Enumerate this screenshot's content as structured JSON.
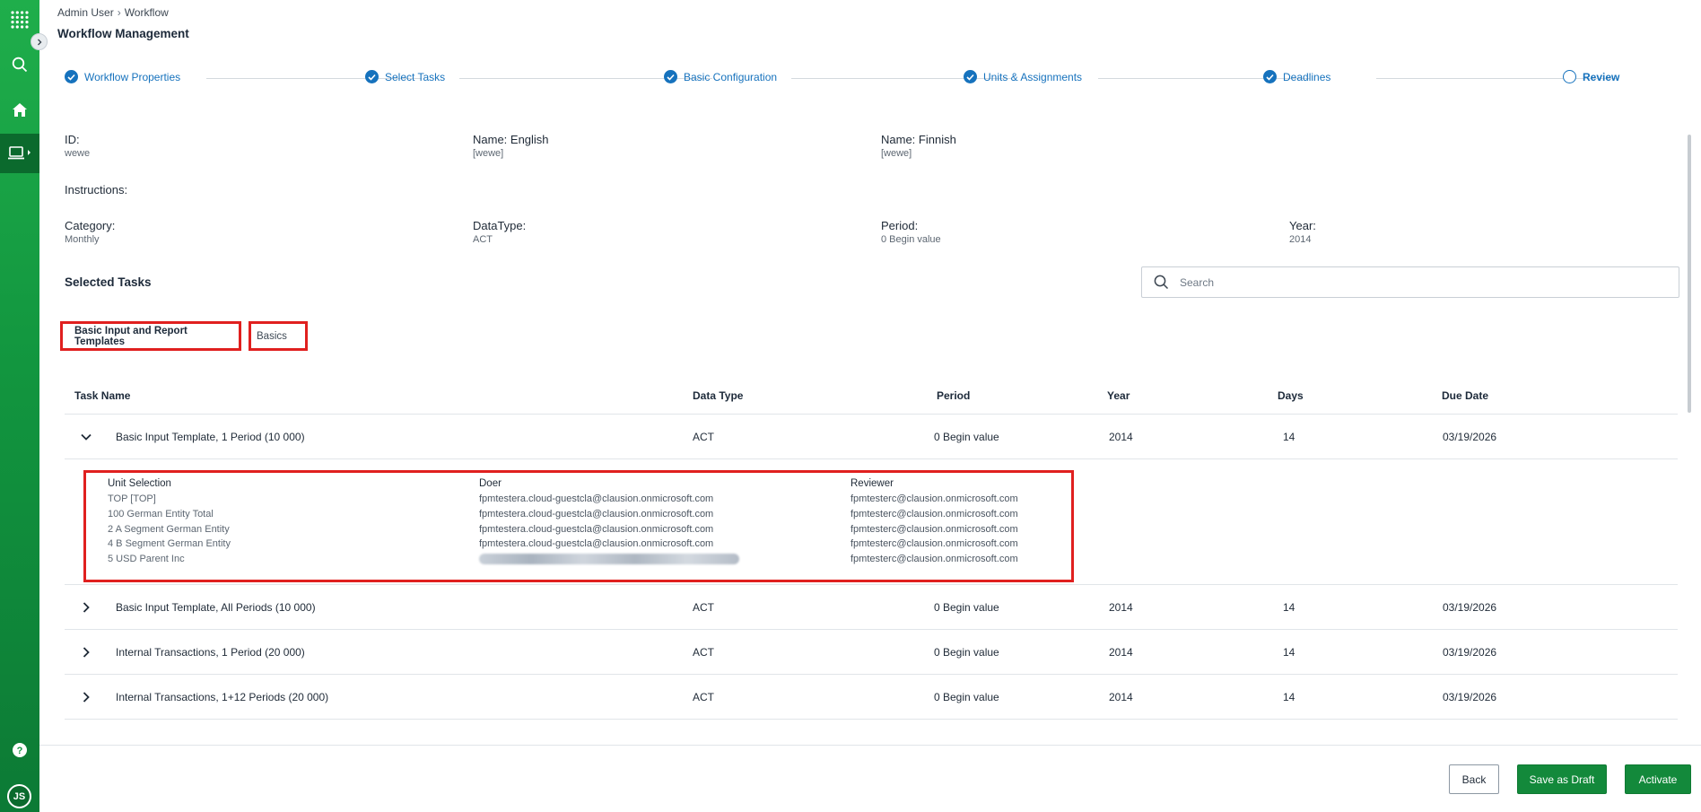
{
  "breadcrumb": {
    "parent": "Admin User",
    "separator": "›",
    "current": "Workflow"
  },
  "page_title": "Workflow Management",
  "stepper": [
    {
      "label": "Workflow Properties",
      "state": "done"
    },
    {
      "label": "Select Tasks",
      "state": "done"
    },
    {
      "label": "Basic Configuration",
      "state": "done"
    },
    {
      "label": "Units & Assignments",
      "state": "done"
    },
    {
      "label": "Deadlines",
      "state": "done"
    },
    {
      "label": "Review",
      "state": "current"
    }
  ],
  "properties": {
    "id": {
      "label": "ID:",
      "value": "wewe"
    },
    "name_en": {
      "label": "Name: English",
      "value": "[wewe]"
    },
    "name_fi": {
      "label": "Name: Finnish",
      "value": "[wewe]"
    },
    "instructions": {
      "label": "Instructions:"
    },
    "category": {
      "label": "Category:",
      "value": "Monthly"
    },
    "datatype": {
      "label": "DataType:",
      "value": "ACT"
    },
    "period": {
      "label": "Period:",
      "value": "0 Begin value"
    },
    "year": {
      "label": "Year:",
      "value": "2014"
    }
  },
  "selected_tasks_title": "Selected Tasks",
  "search": {
    "placeholder": "Search"
  },
  "tabs": [
    {
      "label": "Basic Input and Report Templates",
      "active": true
    },
    {
      "label": "Basics",
      "active": false
    }
  ],
  "table": {
    "columns": [
      "Task Name",
      "Data Type",
      "Period",
      "Year",
      "Days",
      "Due Date"
    ],
    "rows": [
      {
        "name": "Basic Input Template, 1 Period (10 000)",
        "data_type": "ACT",
        "period": "0 Begin value",
        "year": "2014",
        "days": "14",
        "due": "03/19/2026",
        "expanded": true
      },
      {
        "name": "Basic Input Template, All Periods (10 000)",
        "data_type": "ACT",
        "period": "0 Begin value",
        "year": "2014",
        "days": "14",
        "due": "03/19/2026",
        "expanded": false
      },
      {
        "name": "Internal Transactions, 1 Period (20 000)",
        "data_type": "ACT",
        "period": "0 Begin value",
        "year": "2014",
        "days": "14",
        "due": "03/19/2026",
        "expanded": false
      },
      {
        "name": "Internal Transactions, 1+12 Periods (20 000)",
        "data_type": "ACT",
        "period": "0 Begin value",
        "year": "2014",
        "days": "14",
        "due": "03/19/2026",
        "expanded": false
      }
    ]
  },
  "assignments": {
    "headers": {
      "unit": "Unit Selection",
      "doer": "Doer",
      "reviewer": "Reviewer"
    },
    "units": [
      "TOP [TOP]",
      "100 German Entity Total",
      "2 A Segment German Entity",
      "4 B Segment German Entity",
      "5 USD Parent Inc"
    ],
    "doers": [
      "fpmtestera.cloud-guestcla@clausion.onmicrosoft.com",
      "fpmtestera.cloud-guestcla@clausion.onmicrosoft.com",
      "fpmtestera.cloud-guestcla@clausion.onmicrosoft.com",
      "fpmtestera.cloud-guestcla@clausion.onmicrosoft.com"
    ],
    "reviewers": [
      "fpmtesterc@clausion.onmicrosoft.com",
      "fpmtesterc@clausion.onmicrosoft.com",
      "fpmtesterc@clausion.onmicrosoft.com",
      "fpmtesterc@clausion.onmicrosoft.com",
      "fpmtesterc@clausion.onmicrosoft.com"
    ]
  },
  "rail": {
    "avatar_initials": "JS"
  },
  "footer": {
    "back": "Back",
    "save_draft": "Save as Draft",
    "activate": "Activate"
  },
  "colors": {
    "accent": "#1672bd",
    "brand_green": "#13893b",
    "highlight_red": "#e0201f"
  }
}
